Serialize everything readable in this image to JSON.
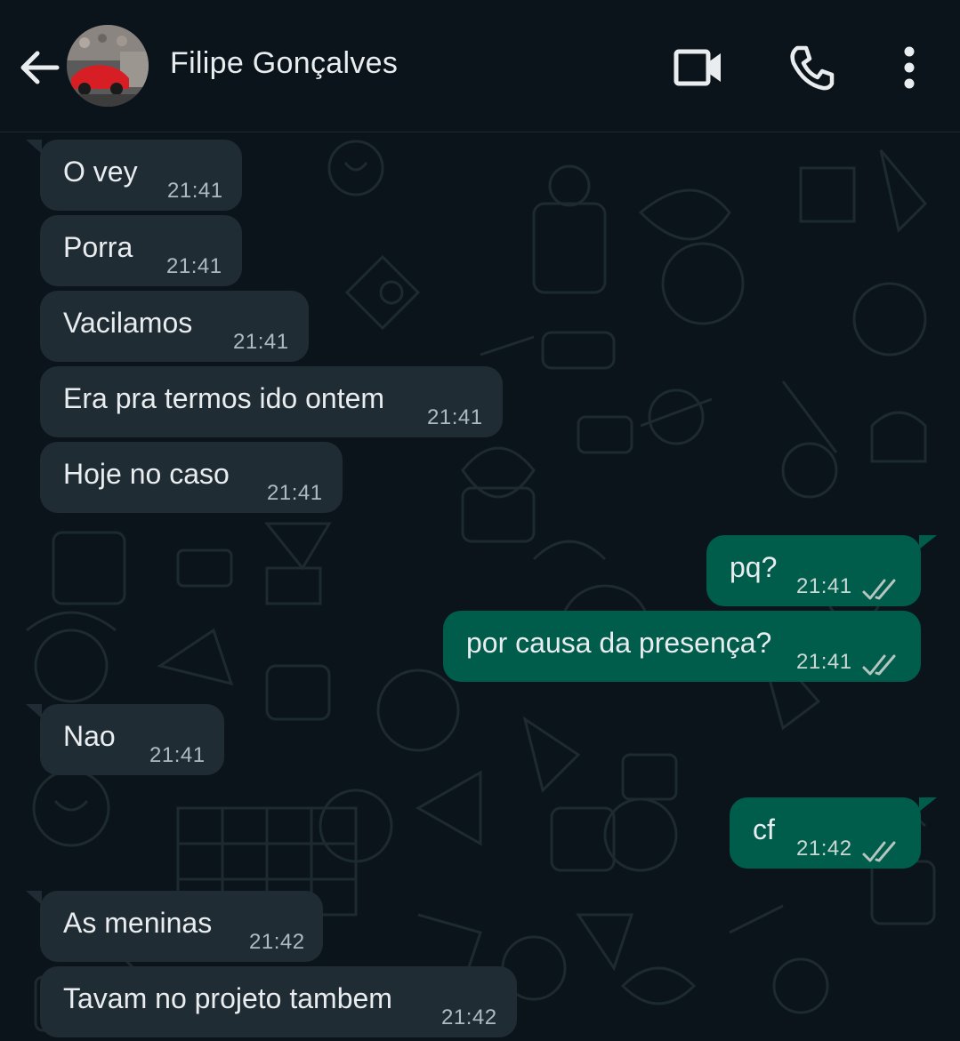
{
  "header": {
    "contact_name": "Filipe Gonçalves",
    "back_icon": "arrow-left-icon",
    "video_icon": "video-call-icon",
    "call_icon": "phone-icon",
    "menu_icon": "more-vertical-icon"
  },
  "colors": {
    "background": "#0b141a",
    "incoming_bubble": "#202c33",
    "outgoing_bubble": "#005c4b",
    "text": "#e9edef",
    "timestamp": "#aebac1"
  },
  "messages": [
    {
      "direction": "in",
      "text": "O vey",
      "time": "21:41"
    },
    {
      "direction": "in",
      "text": "Porra",
      "time": "21:41"
    },
    {
      "direction": "in",
      "text": "Vacilamos",
      "time": "21:41"
    },
    {
      "direction": "in",
      "text": "Era pra termos ido ontem",
      "time": "21:41"
    },
    {
      "direction": "in",
      "text": "Hoje no caso",
      "time": "21:41"
    },
    {
      "direction": "out",
      "text": "pq?",
      "time": "21:41",
      "status": "read"
    },
    {
      "direction": "out",
      "text": "por causa da presença?",
      "time": "21:41",
      "status": "read"
    },
    {
      "direction": "in",
      "text": "Nao",
      "time": "21:41"
    },
    {
      "direction": "out",
      "text": "cf",
      "time": "21:42",
      "status": "read"
    },
    {
      "direction": "in",
      "text": "As meninas",
      "time": "21:42"
    },
    {
      "direction": "in",
      "text": "Tavam no projeto tambem",
      "time": "21:42"
    }
  ]
}
